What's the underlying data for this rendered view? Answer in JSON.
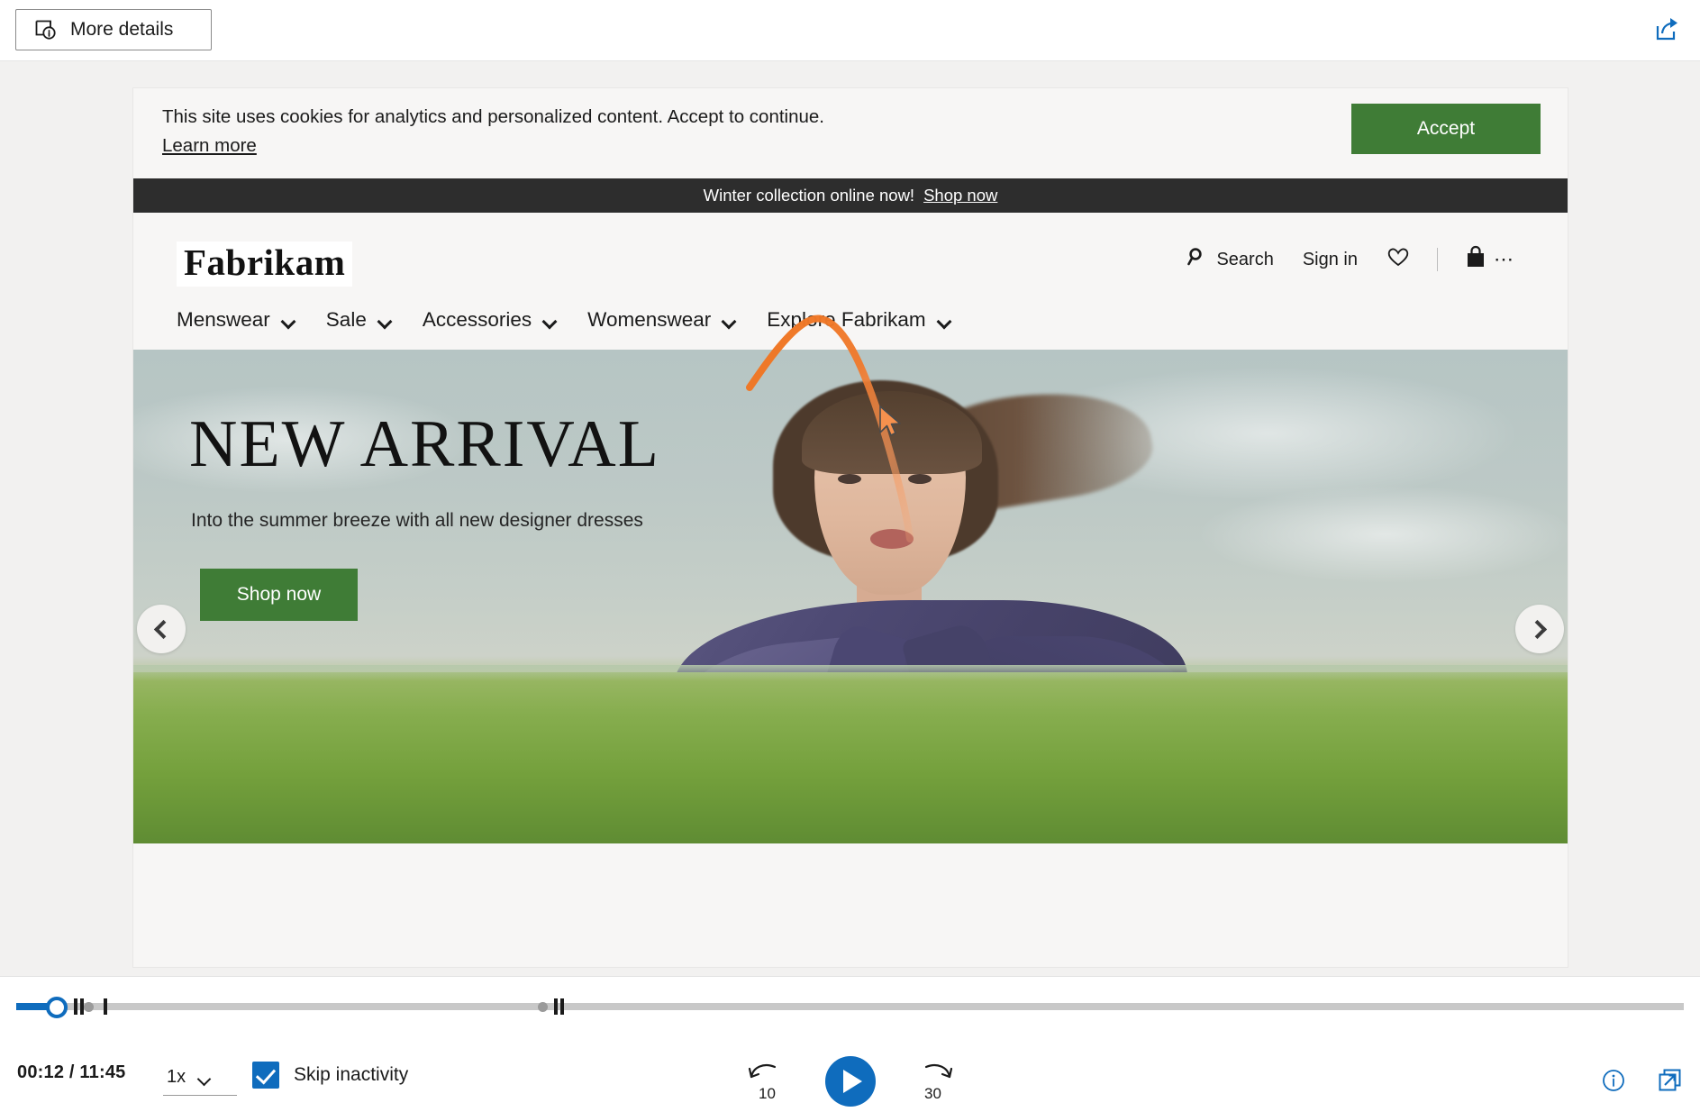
{
  "topbar": {
    "more_details_label": "More details",
    "more_details_icon": "video-details-icon",
    "share_icon": "share-icon"
  },
  "page_content": {
    "cookie_banner": {
      "message": "This site uses cookies for analytics and personalized content. Accept to continue.",
      "learn_more_label": "Learn more",
      "accept_label": "Accept",
      "accept_color": "#3f7c36"
    },
    "promo_bar": {
      "message": "Winter collection online now!",
      "link_label": "Shop now",
      "background": "#2d2d2d"
    },
    "site_header": {
      "logo_text": "Fabrikam",
      "search_label": "Search",
      "search_icon": "search-icon",
      "signin_label": "Sign in",
      "wishlist_icon": "heart-icon",
      "bag_icon": "shopping-bag-icon",
      "overflow_icon": "ellipsis-icon"
    },
    "nav": {
      "items": [
        {
          "label": "Menswear",
          "icon": "chevron-down-icon"
        },
        {
          "label": "Sale",
          "icon": "chevron-down-icon"
        },
        {
          "label": "Accessories",
          "icon": "chevron-down-icon"
        },
        {
          "label": "Womenswear",
          "icon": "chevron-down-icon"
        },
        {
          "label": "Explore Fabrikam",
          "icon": "chevron-down-icon"
        }
      ]
    },
    "hero": {
      "title": "NEW ARRIVAL",
      "subtitle": "Into the summer breeze with all new designer dresses",
      "cta_label": "Shop now",
      "cta_color": "#3f7c36",
      "prev_icon": "chevron-left-icon",
      "next_icon": "chevron-right-icon",
      "image_description": "Woman in a purple coat in a green field under a pale sky"
    },
    "annotation": {
      "type": "mouse-trail",
      "color": "#f0792b",
      "cursor_icon": "mouse-pointer-icon"
    }
  },
  "player": {
    "current_time": "00:12",
    "total_time": "11:45",
    "time_display": "00:12 / 11:45",
    "speed_label": "1x",
    "speed_icon": "chevron-down-icon",
    "skip_inactivity_label": "Skip inactivity",
    "skip_inactivity_checked": true,
    "rewind_label": "10",
    "rewind_icon": "rewind-10-icon",
    "forward_label": "30",
    "forward_icon": "forward-30-icon",
    "play_icon": "play-icon",
    "info_icon": "info-icon",
    "popout_icon": "open-in-new-window-icon",
    "accent_color": "#0f6cbd",
    "progress_percent": 1.7
  }
}
